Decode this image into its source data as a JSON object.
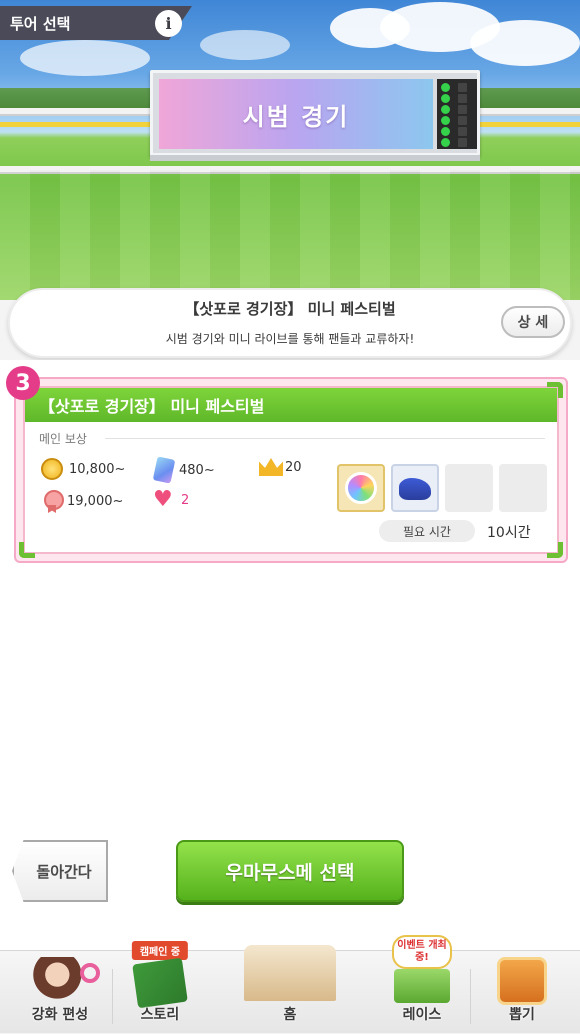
{
  "header": {
    "tab_title": "투어 선택",
    "info_icon": "i"
  },
  "scene": {
    "scoreboard_text": "시범 경기"
  },
  "event_banner": {
    "title": "【삿포로 경기장】 미니 페스티벌",
    "description": "시범 경기와 미니 라이브를 통해 팬들과 교류하자!",
    "detail_button": "상 세"
  },
  "selection_badge": "3",
  "tour_card": {
    "title": "【삿포로 경기장】 미니 페스티벌",
    "section_label": "메인 보상",
    "rewards": [
      {
        "icon": "coin-icon",
        "value": "10,800~"
      },
      {
        "icon": "support-card-icon",
        "value": "480~"
      },
      {
        "icon": "crown-icon",
        "value": "20"
      },
      {
        "icon": "fan-medal-icon",
        "value": "19,000~"
      },
      {
        "icon": "heart-icon",
        "value": "2"
      }
    ],
    "item_slots": [
      "rainbow-clover-icon",
      "running-shoes-icon",
      "empty",
      "empty"
    ],
    "time_label": "필요 시간",
    "time_value": "10시간"
  },
  "actions": {
    "back_button": "돌아간다",
    "primary_button": "우마무스메 선택"
  },
  "nav": {
    "items": [
      {
        "label": "강화 편성",
        "badge": ""
      },
      {
        "label": "스토리",
        "badge": "캠페인 중"
      },
      {
        "label": "홈",
        "badge": ""
      },
      {
        "label": "레이스",
        "badge": "이벤트 개최 중!"
      },
      {
        "label": "뽑기",
        "badge": ""
      }
    ]
  },
  "colors": {
    "accent_green": "#5fb82a",
    "badge_pink": "#e43c89",
    "heart": "#ef4f7c"
  }
}
